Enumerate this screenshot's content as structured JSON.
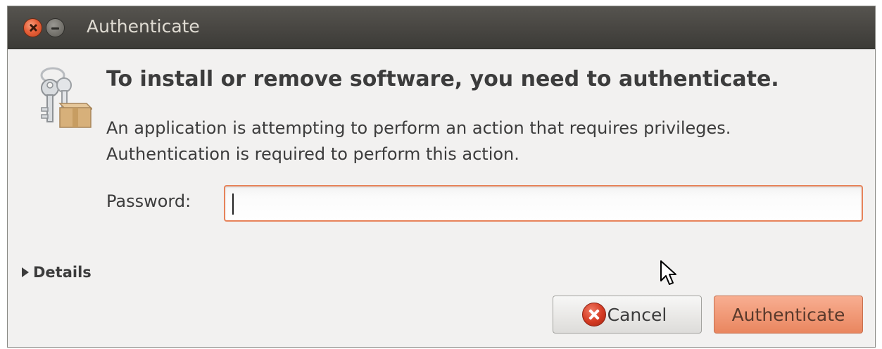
{
  "window": {
    "title": "Authenticate"
  },
  "dialog": {
    "heading": "To install or remove software, you need to authenticate.",
    "message_line1": "An application is attempting to perform an action that requires privileges.",
    "message_line2": "Authentication is required to perform this action.",
    "password_label": "Password:",
    "password_value": "",
    "details_label": "Details",
    "cancel_label": "Cancel",
    "authenticate_label": "Authenticate"
  },
  "icons": {
    "close": "close-icon",
    "minimize": "minimize-icon",
    "dialog": "keys-package-icon",
    "cancel": "cancel-icon",
    "details": "expander-arrow-icon"
  },
  "colors": {
    "titlebar": "#3c3b37",
    "window_bg": "#f2f1f0",
    "accent": "#f19a78",
    "focus_border": "#e7835a",
    "text": "#3c3c3c"
  }
}
